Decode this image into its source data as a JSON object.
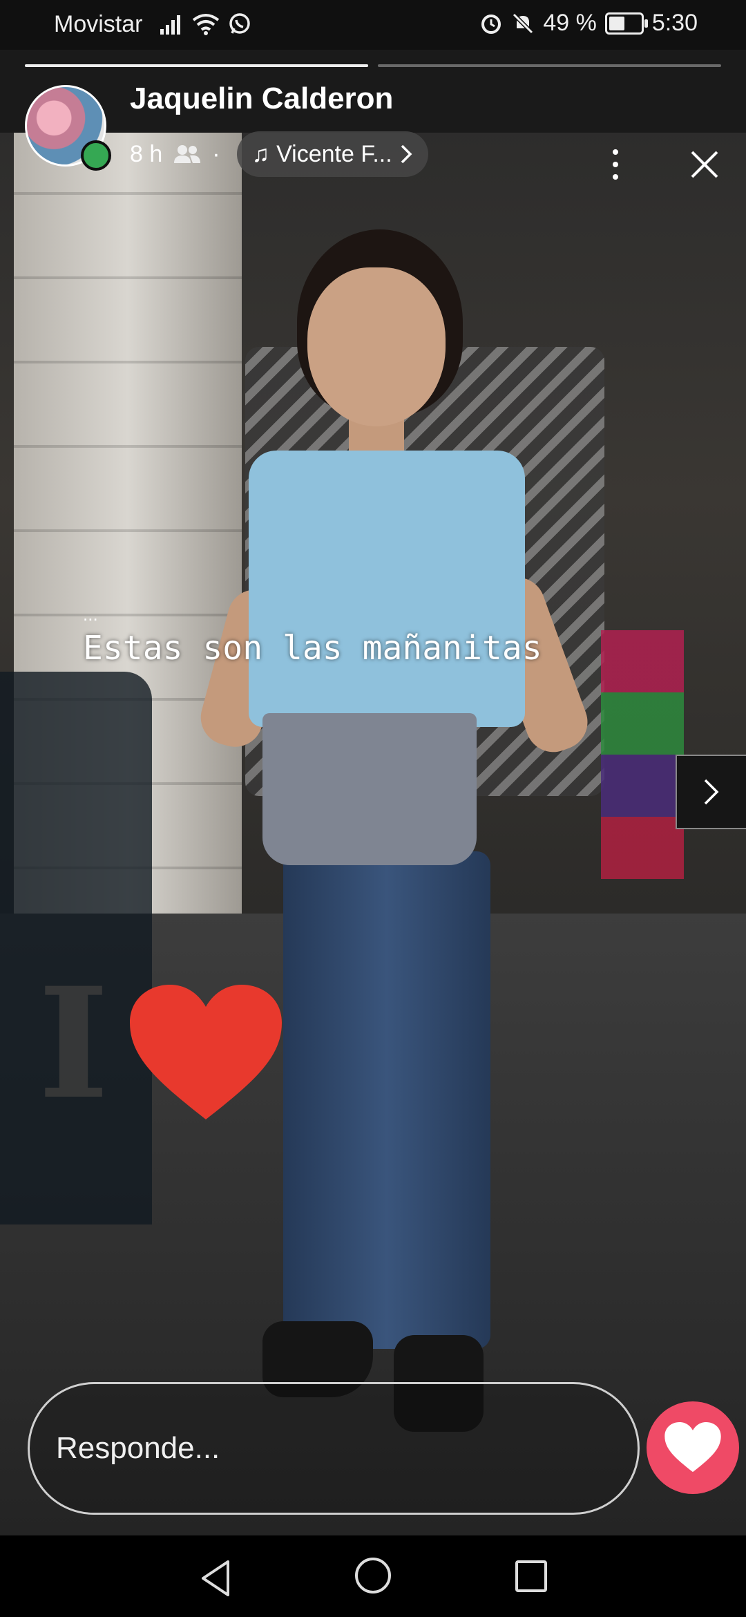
{
  "status_bar": {
    "carrier": "Movistar",
    "battery_percent": "49 %",
    "battery_level": 0.49,
    "time": "5:30",
    "icons": [
      "signal-icon",
      "wifi-icon",
      "whatsapp-icon",
      "alarm-icon",
      "mute-icon",
      "battery-icon"
    ]
  },
  "story": {
    "progress": [
      1.0,
      0.0
    ],
    "user_name": "Jaquelin Calderon",
    "time_ago": "8 h",
    "audience_icon": "friends-icon",
    "separator": "·",
    "music_label": "Vicente F...",
    "caption_dots": "...",
    "caption": "Estas son las mañanitas",
    "sticker_letter": "I",
    "heart_color": "#e8392d"
  },
  "reply": {
    "placeholder": "Responde...",
    "like_color": "#ef4a66"
  },
  "nav": {
    "icons": [
      "back-icon",
      "home-icon",
      "recent-apps-icon"
    ]
  }
}
